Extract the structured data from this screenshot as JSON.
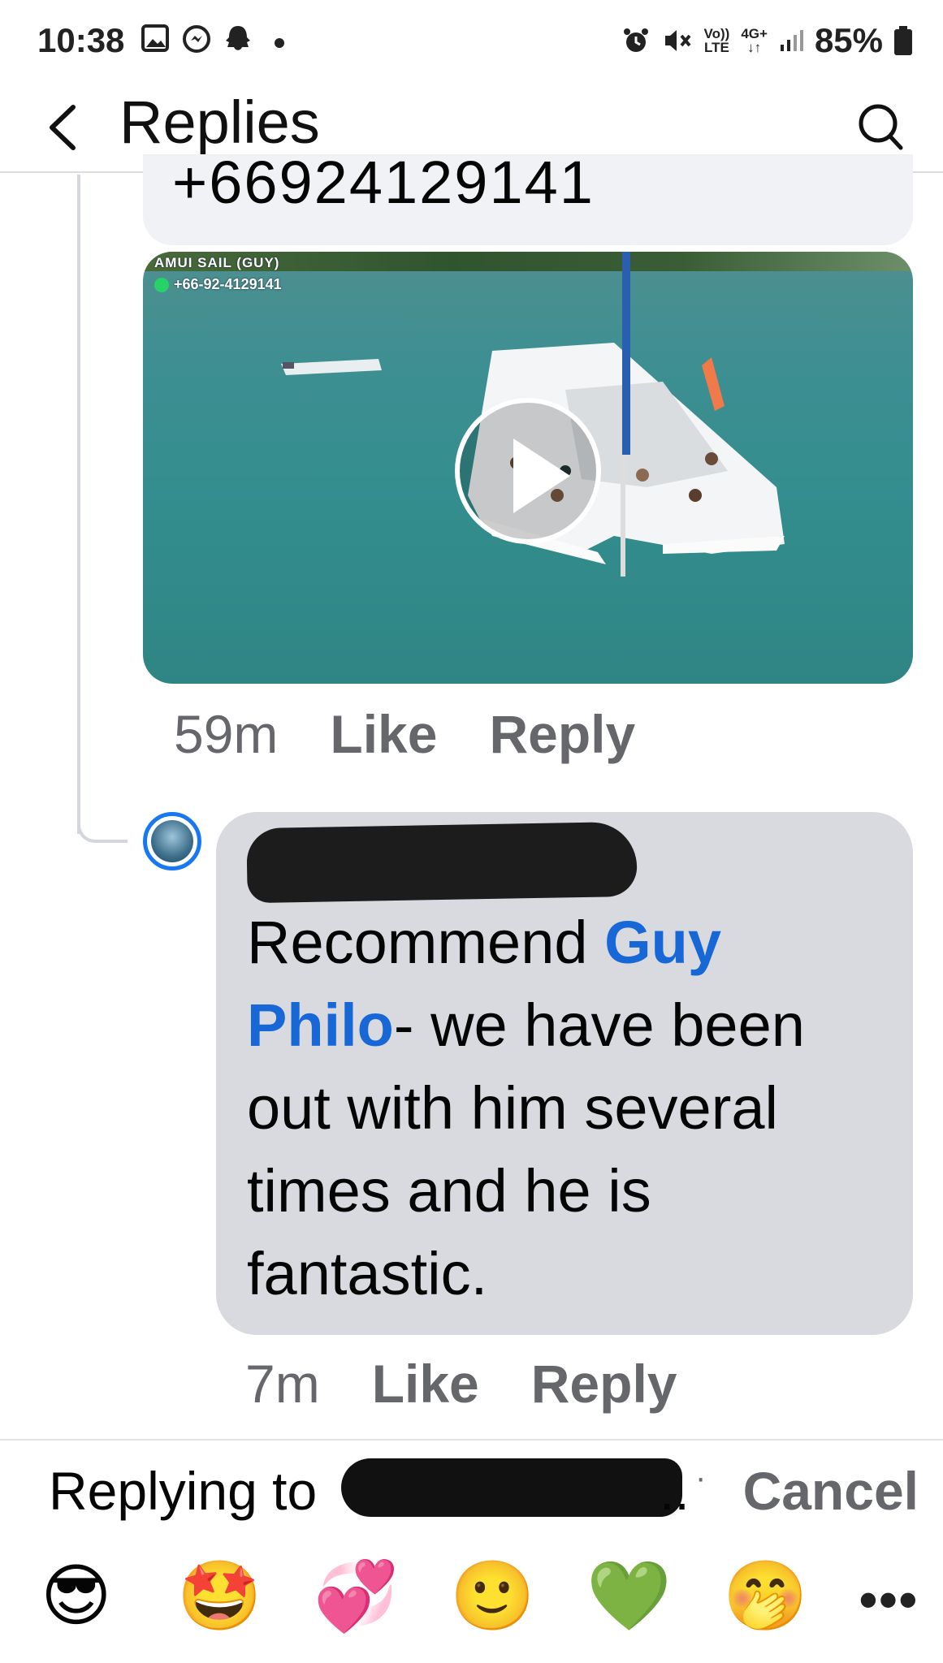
{
  "status_bar": {
    "time": "10:38",
    "network_top": "Vo))",
    "network_bottom": "LTE",
    "gen_top": "4G+",
    "gen_bottom": "↓↑",
    "battery": "85%"
  },
  "header": {
    "title": "Replies"
  },
  "first_reply": {
    "phone_text": "+66924129141",
    "video_watermark_line1": "AMUI SAIL (GUY)",
    "video_watermark_line2": "+66-92-4129141",
    "time": "59m",
    "like": "Like",
    "reply": "Reply"
  },
  "second_reply": {
    "text_pre": "Recommend ",
    "mention": "Guy Philo",
    "text_post": "- we have been out with him several times and he is fantastic.",
    "time": "7m",
    "like": "Like",
    "reply": "Reply"
  },
  "reply_bar": {
    "replying_to": "Replying to",
    "dots": "..",
    "separator": "·",
    "cancel": "Cancel"
  },
  "emoji_bar": {
    "emojis": [
      "😎",
      "🤩",
      "💞",
      "🙂",
      "💚",
      "🤭"
    ],
    "more": "•••"
  }
}
